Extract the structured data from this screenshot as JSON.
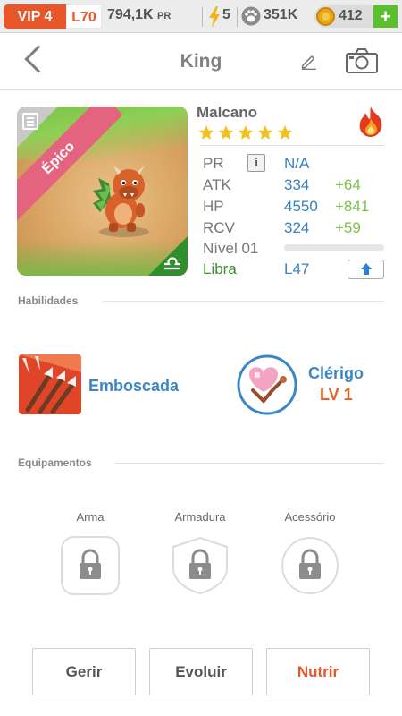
{
  "status": {
    "vip": "VIP 4",
    "level": "L70",
    "power": "794,1K",
    "power_unit": "PR",
    "energy": "5",
    "paw": "351K",
    "coins": "412",
    "add_label": "+"
  },
  "header": {
    "title": "King"
  },
  "monster": {
    "rarity": "Épico",
    "name": "Malcano",
    "stars": 5,
    "element": "fire",
    "stats": {
      "pr_label": "PR",
      "pr_info": "i",
      "pr_value": "N/A",
      "atk_label": "ATK",
      "atk_value": "334",
      "atk_plus": "+64",
      "hp_label": "HP",
      "hp_value": "4550",
      "hp_plus": "+841",
      "rcv_label": "RCV",
      "rcv_value": "324",
      "rcv_plus": "+59",
      "level_label": "Nível 01",
      "level_progress": 0.0,
      "sign_label": "Libra",
      "sign_level": "L47"
    }
  },
  "abilities": {
    "section_label": "Habilidades",
    "skill1": {
      "name": "Emboscada"
    },
    "skill2": {
      "name": "Clérigo",
      "level": "LV 1"
    }
  },
  "equipment": {
    "section_label": "Equipamentos",
    "slots": [
      {
        "label": "Arma"
      },
      {
        "label": "Armadura"
      },
      {
        "label": "Acessório"
      }
    ]
  },
  "actions": {
    "manage": "Gerir",
    "evolve": "Evoluir",
    "feed": "Nutrir"
  },
  "colors": {
    "accent_orange": "#e8572a",
    "stat_blue": "#3a80c0",
    "plus_green": "#7cc24a",
    "libra_green": "#3a8f2a",
    "rarity_pink": "#e4637e"
  }
}
